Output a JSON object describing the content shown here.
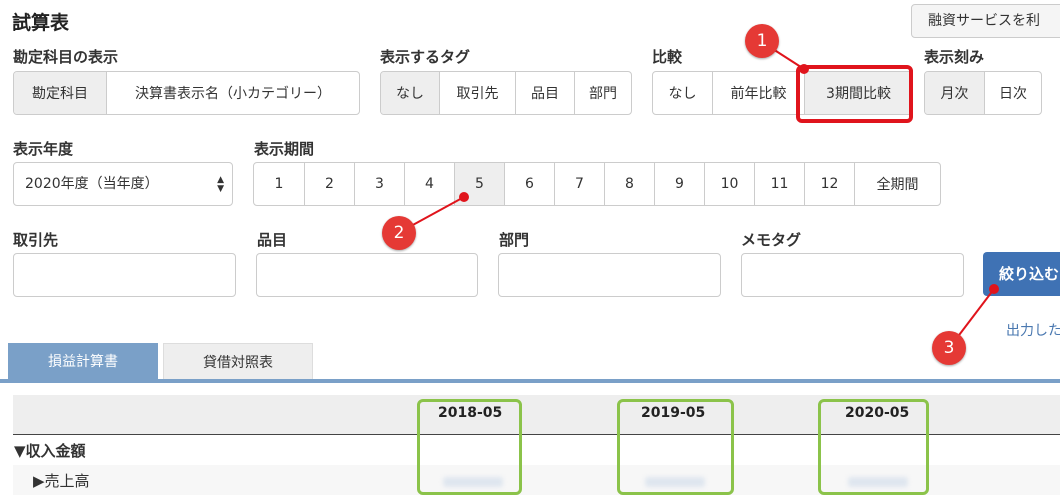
{
  "page": {
    "title": "試算表"
  },
  "topbar": {
    "partial_button": "融資サービスを利"
  },
  "account_display": {
    "label": "勘定科目の表示",
    "options": [
      "勘定科目",
      "決算書表示名（小カテゴリー）"
    ],
    "selected": "勘定科目"
  },
  "tags": {
    "label": "表示するタグ",
    "options": [
      "なし",
      "取引先",
      "品目",
      "部門"
    ],
    "selected": "なし"
  },
  "compare": {
    "label": "比較",
    "options": [
      "なし",
      "前年比較",
      "3期間比較"
    ],
    "selected": "3期間比較"
  },
  "granularity": {
    "label": "表示刻み",
    "options": [
      "月次",
      "日次"
    ],
    "selected": "月次"
  },
  "fiscal_year": {
    "label": "表示年度",
    "value": "2020年度（当年度）"
  },
  "period": {
    "label": "表示期間",
    "options": [
      "1",
      "2",
      "3",
      "4",
      "5",
      "6",
      "7",
      "8",
      "9",
      "10",
      "11",
      "12",
      "全期間"
    ],
    "selected": "5"
  },
  "filters": {
    "partner_label": "取引先",
    "item_label": "品目",
    "dept_label": "部門",
    "memo_label": "メモタグ"
  },
  "filter_button": {
    "label": "絞り込む"
  },
  "output_link": {
    "text": "出力した"
  },
  "tabs": {
    "items": [
      "損益計算書",
      "貸借対照表"
    ],
    "active": "損益計算書"
  },
  "table": {
    "columns": [
      "2018-05",
      "2019-05",
      "2020-05"
    ],
    "rows": [
      {
        "label": "▼収入金額"
      },
      {
        "label": "▶売上高"
      }
    ]
  },
  "annotations": {
    "markers": [
      "1",
      "2",
      "3"
    ],
    "marker_color": "#e53935",
    "highlight_color": "#8bc34a"
  }
}
